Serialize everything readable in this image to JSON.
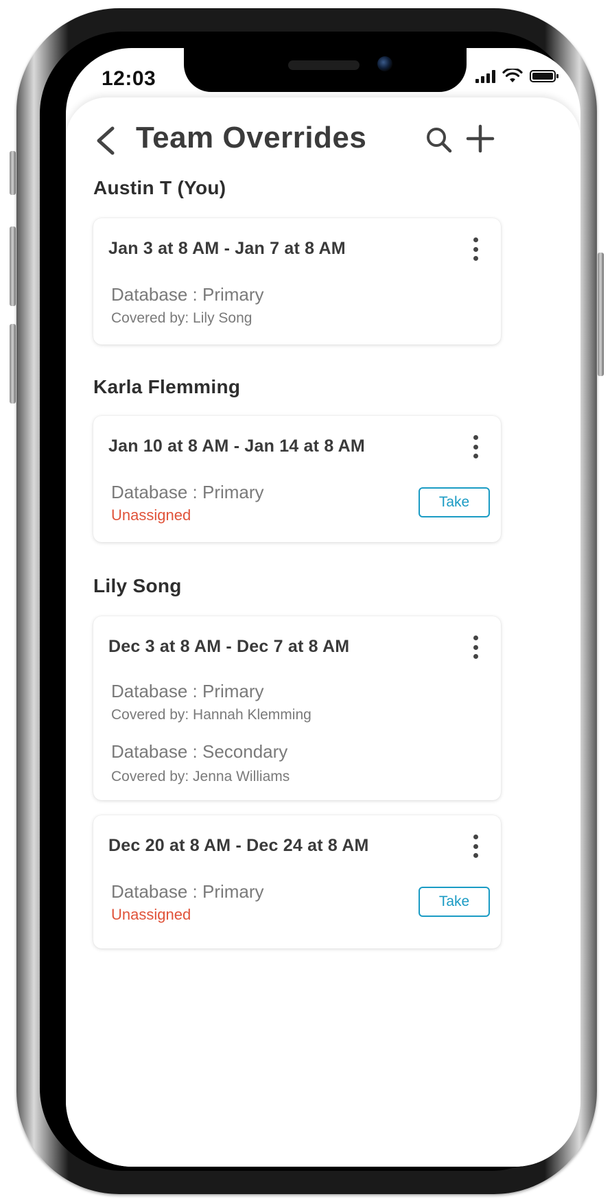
{
  "status_bar": {
    "time": "12:03"
  },
  "header": {
    "title": "Team Overrides"
  },
  "sections": [
    {
      "person": "Austin T (You)",
      "cards": [
        {
          "date_range": "Jan 3 at 8 AM - Jan 7 at 8 AM",
          "entries": [
            {
              "database": "Database : Primary",
              "status": "Covered by: Lily Song"
            }
          ]
        }
      ]
    },
    {
      "person": "Karla Flemming",
      "cards": [
        {
          "date_range": "Jan 10 at 8 AM - Jan 14 at 8 AM",
          "entries": [
            {
              "database": "Database : Primary",
              "status": "Unassigned"
            }
          ],
          "action": "Take"
        }
      ]
    },
    {
      "person": "Lily Song",
      "cards": [
        {
          "date_range": "Dec 3 at 8 AM - Dec 7 at 8 AM",
          "entries": [
            {
              "database": "Database : Primary",
              "status": "Covered by: Hannah Klemming"
            },
            {
              "database": "Database : Secondary",
              "status": "Covered by: Jenna Williams"
            }
          ]
        },
        {
          "date_range": "Dec 20 at 8 AM - Dec 24 at 8 AM",
          "entries": [
            {
              "database": "Database : Primary",
              "status": "Unassigned"
            }
          ],
          "action": "Take"
        }
      ]
    }
  ],
  "colors": {
    "accent": "#1a9bc4",
    "unassigned": "#e0533a",
    "text": "#3a3a3a",
    "muted": "#7a7a7a"
  },
  "icons": [
    "back-chevron-icon",
    "search-icon",
    "plus-icon",
    "more-vertical-icon",
    "cellular-signal-icon",
    "wifi-icon",
    "battery-icon"
  ]
}
